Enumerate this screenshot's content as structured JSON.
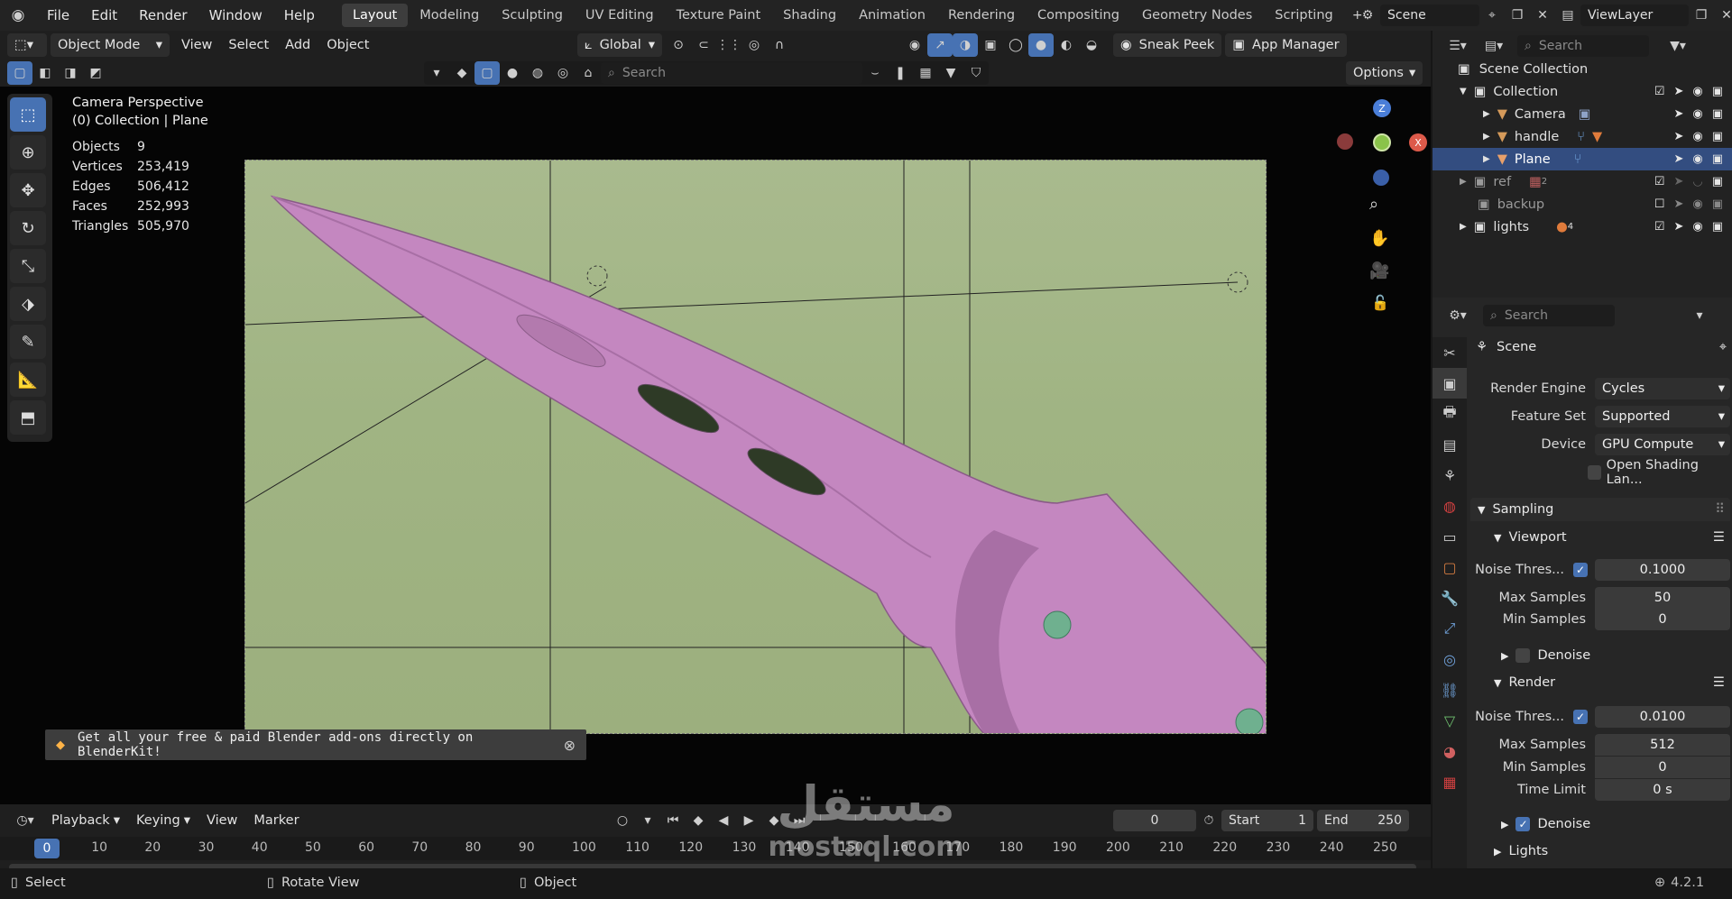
{
  "menu": [
    "File",
    "Edit",
    "Render",
    "Window",
    "Help"
  ],
  "workspaces": [
    "Layout",
    "Modeling",
    "Sculpting",
    "UV Editing",
    "Texture Paint",
    "Shading",
    "Animation",
    "Rendering",
    "Compositing",
    "Geometry Nodes",
    "Scripting"
  ],
  "scene_name": "Scene",
  "view_layer": "ViewLayer",
  "viewport_header": {
    "mode": "Object Mode",
    "menus": [
      "View",
      "Select",
      "Add",
      "Object"
    ],
    "transform": "Global",
    "sneak_peek": "Sneak Peek",
    "app_manager": "App Manager",
    "search_placeholder": "Search",
    "options": "Options"
  },
  "viewport_info": {
    "title": "Camera Perspective",
    "subtitle": "(0) Collection | Plane",
    "stats": [
      {
        "label": "Objects",
        "value": "9"
      },
      {
        "label": "Vertices",
        "value": "253,419"
      },
      {
        "label": "Edges",
        "value": "506,412"
      },
      {
        "label": "Faces",
        "value": "252,993"
      },
      {
        "label": "Triangles",
        "value": "505,970"
      }
    ]
  },
  "gizmo": {
    "z": "Z",
    "x": "X"
  },
  "banner": "Get all your free & paid Blender add-ons directly on BlenderKit!",
  "outliner": {
    "search_placeholder": "Search",
    "root": "Scene Collection",
    "rows": [
      {
        "name": "Collection"
      },
      {
        "name": "Camera"
      },
      {
        "name": "handle"
      },
      {
        "name": "Plane"
      },
      {
        "name": "ref",
        "badge": "2"
      },
      {
        "name": "backup"
      },
      {
        "name": "lights",
        "badge": "4"
      }
    ]
  },
  "properties": {
    "search_placeholder": "Search",
    "context": "Scene",
    "render_engine_label": "Render Engine",
    "render_engine": "Cycles",
    "feature_set_label": "Feature Set",
    "feature_set": "Supported",
    "device_label": "Device",
    "device": "GPU Compute",
    "open_shading": "Open Shading Lan...",
    "sampling": "Sampling",
    "viewport": "Viewport",
    "vp_noise_label": "Noise Thres...",
    "vp_noise": "0.1000",
    "vp_max_label": "Max Samples",
    "vp_max": "50",
    "vp_min_label": "Min Samples",
    "vp_min": "0",
    "denoise": "Denoise",
    "render": "Render",
    "r_noise_label": "Noise Thres...",
    "r_noise": "0.0100",
    "r_max_label": "Max Samples",
    "r_max": "512",
    "r_min_label": "Min Samples",
    "r_min": "0",
    "time_limit_label": "Time Limit",
    "time_limit": "0 s",
    "r_denoise": "Denoise",
    "lights": "Lights"
  },
  "timeline": {
    "menus": [
      "Playback",
      "Keying",
      "View",
      "Marker"
    ],
    "current_frame": "0",
    "start_label": "Start",
    "start": "1",
    "end_label": "End",
    "end": "250",
    "ticks": [
      "0",
      "10",
      "20",
      "30",
      "40",
      "50",
      "60",
      "70",
      "80",
      "90",
      "100",
      "110",
      "120",
      "130",
      "140",
      "150",
      "160",
      "170",
      "180",
      "190",
      "200",
      "210",
      "220",
      "230",
      "240",
      "250"
    ]
  },
  "statusbar": {
    "select": "Select",
    "rotate": "Rotate View",
    "object": "Object",
    "version": "4.2.1"
  },
  "watermark": {
    "arabic": "مستقل",
    "latin": "mostaql.com"
  },
  "colors": {
    "accent": "#4772b3",
    "blade": "#c487c0",
    "backdrop": "#a3b687"
  }
}
